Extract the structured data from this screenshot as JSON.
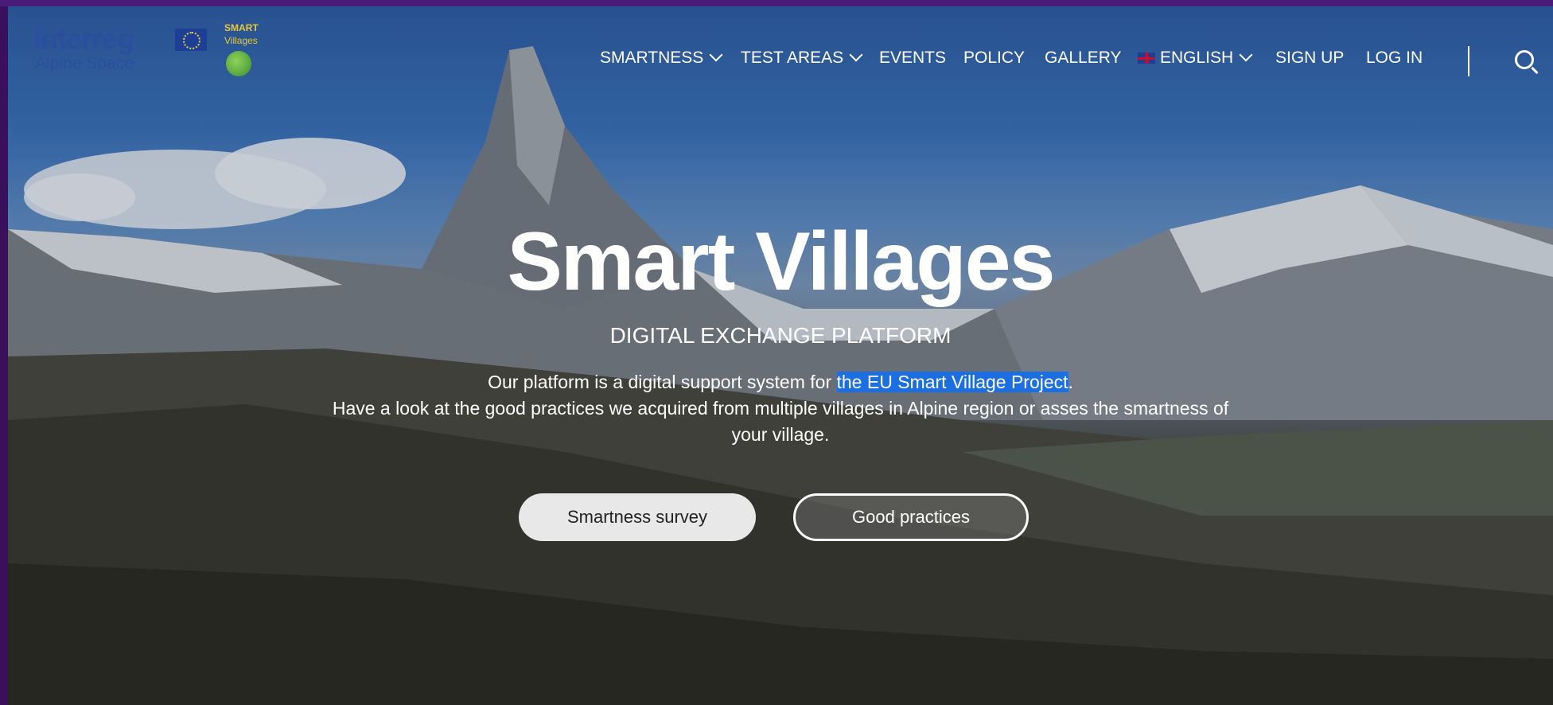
{
  "brand": {
    "interreg_title": "Interreg",
    "interreg_subtitle": "Alpine Space",
    "smart_villages_title": "SMART",
    "smart_villages_subtitle": "Villages"
  },
  "nav": {
    "items": [
      {
        "label": "SMARTNESS",
        "dropdown": true
      },
      {
        "label": "TEST AREAS",
        "dropdown": true
      },
      {
        "label": "EVENTS",
        "dropdown": false
      },
      {
        "label": "POLICY",
        "dropdown": false
      },
      {
        "label": "GALLERY",
        "dropdown": false
      },
      {
        "label": "ENGLISH",
        "dropdown": true
      },
      {
        "label": "SIGN UP",
        "dropdown": false
      },
      {
        "label": "LOG IN",
        "dropdown": false
      }
    ]
  },
  "hero": {
    "title": "Smart Villages",
    "subtitle": "DIGITAL EXCHANGE PLATFORM",
    "line1_prefix": "Our platform is a digital support system for ",
    "line1_link": "the EU Smart Village Project",
    "line1_suffix": ".",
    "line2": "Have a look at the good practices we acquired from multiple villages in Alpine region or asses the smartness of your village."
  },
  "buttons": {
    "survey": "Smartness survey",
    "practices": "Good practices"
  },
  "colors": {
    "page_frame": "#3a0f5c",
    "highlight": "#1c6fe0",
    "brand_blue": "#2a4f9f",
    "brand_yellow": "#e6c739"
  }
}
